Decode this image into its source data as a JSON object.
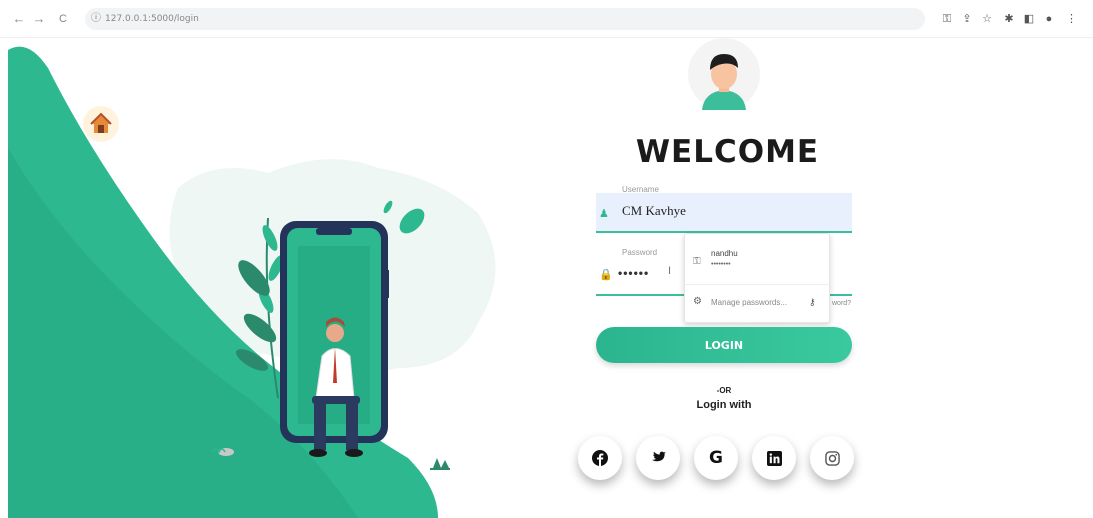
{
  "browser": {
    "url": "127.0.0.1:5000/login",
    "nav_back": "←",
    "nav_forward": "→",
    "nav_reload": "C"
  },
  "page": {
    "welcome": "WELCOME",
    "username": {
      "label": "Username",
      "value": "CM Kavhye"
    },
    "password": {
      "label": "Password",
      "value": "••••••"
    },
    "forgot_fragment": "word?",
    "autofill": {
      "saved_user": "nandhu",
      "saved_password_mask": "••••••••",
      "manage_label": "Manage passwords..."
    },
    "login_button": "LOGIN",
    "or_text": "-OR",
    "login_with": "Login with",
    "social": [
      {
        "name": "facebook",
        "glyph": "f"
      },
      {
        "name": "twitter",
        "glyph": "t"
      },
      {
        "name": "google",
        "glyph": "G"
      },
      {
        "name": "linkedin",
        "glyph": "in"
      },
      {
        "name": "instagram",
        "glyph": "ig"
      }
    ]
  },
  "colors": {
    "accent": "#2eb88f",
    "accent_light": "#3ac99e",
    "hero_dark": "#229e79"
  }
}
